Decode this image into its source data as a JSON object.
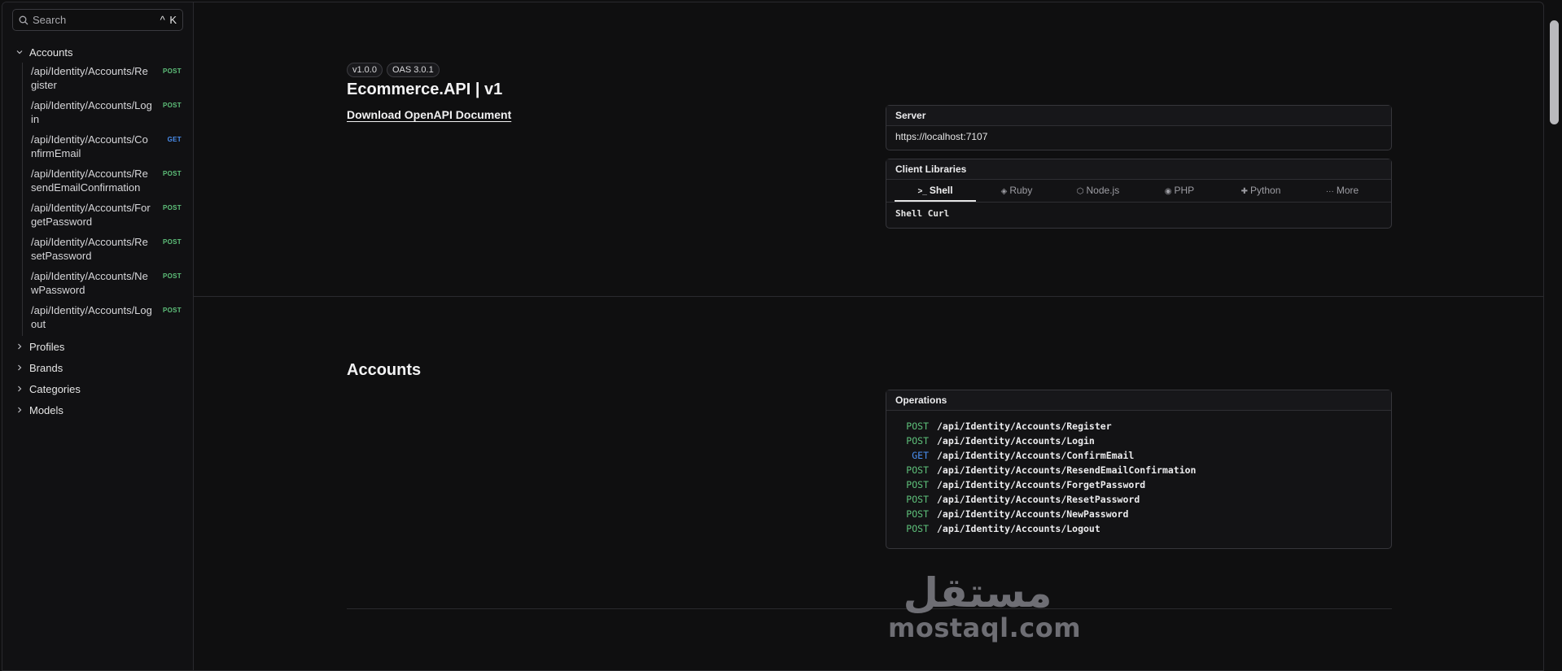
{
  "sidebar": {
    "search_placeholder": "Search",
    "search_shortcut": "^ K",
    "groups": [
      {
        "label": "Accounts",
        "expanded": true,
        "items": [
          {
            "path": "/api/Identity/Accounts/Register",
            "method": "POST"
          },
          {
            "path": "/api/Identity/Accounts/Login",
            "method": "POST"
          },
          {
            "path": "/api/Identity/Accounts/ConfirmEmail",
            "method": "GET"
          },
          {
            "path": "/api/Identity/Accounts/ResendEmailConfirmation",
            "method": "POST"
          },
          {
            "path": "/api/Identity/Accounts/ForgetPassword",
            "method": "POST"
          },
          {
            "path": "/api/Identity/Accounts/ResetPassword",
            "method": "POST"
          },
          {
            "path": "/api/Identity/Accounts/NewPassword",
            "method": "POST"
          },
          {
            "path": "/api/Identity/Accounts/Logout",
            "method": "POST"
          }
        ]
      },
      {
        "label": "Profiles",
        "expanded": false
      },
      {
        "label": "Brands",
        "expanded": false
      },
      {
        "label": "Categories",
        "expanded": false
      },
      {
        "label": "Models",
        "expanded": false
      }
    ]
  },
  "header": {
    "version_pill": "v1.0.0",
    "oas_pill": "OAS 3.0.1",
    "title": "Ecommerce.API | v1",
    "download_link": "Download OpenAPI Document"
  },
  "server": {
    "heading": "Server",
    "url": "https://localhost:7107"
  },
  "client_libraries": {
    "heading": "Client Libraries",
    "tabs": [
      {
        "label": "Shell",
        "icon": "terminal-icon",
        "glyph": ">_",
        "active": true
      },
      {
        "label": "Ruby",
        "icon": "ruby-icon",
        "glyph": "◈",
        "active": false
      },
      {
        "label": "Node.js",
        "icon": "nodejs-icon",
        "glyph": "⬡",
        "active": false
      },
      {
        "label": "PHP",
        "icon": "php-icon",
        "glyph": "◉",
        "active": false
      },
      {
        "label": "Python",
        "icon": "python-icon",
        "glyph": "✚",
        "active": false
      },
      {
        "label": "More",
        "icon": "more-icon",
        "glyph": "···",
        "active": false
      }
    ],
    "snippet": "Shell Curl"
  },
  "accounts_section": {
    "title": "Accounts",
    "operations_heading": "Operations",
    "operations": [
      {
        "method": "POST",
        "path": "/api/Identity/Accounts/Register"
      },
      {
        "method": "POST",
        "path": "/api/Identity/Accounts/Login"
      },
      {
        "method": "GET",
        "path": "/api/Identity/Accounts/ConfirmEmail"
      },
      {
        "method": "POST",
        "path": "/api/Identity/Accounts/ResendEmailConfirmation"
      },
      {
        "method": "POST",
        "path": "/api/Identity/Accounts/ForgetPassword"
      },
      {
        "method": "POST",
        "path": "/api/Identity/Accounts/ResetPassword"
      },
      {
        "method": "POST",
        "path": "/api/Identity/Accounts/NewPassword"
      },
      {
        "method": "POST",
        "path": "/api/Identity/Accounts/Logout"
      }
    ]
  },
  "watermark": {
    "arabic": "مستقل",
    "latin": "mostaql.com"
  },
  "colors": {
    "background": "#0f0f10",
    "post": "#5ec07a",
    "get": "#4a8ff0",
    "border": "#36363b"
  }
}
